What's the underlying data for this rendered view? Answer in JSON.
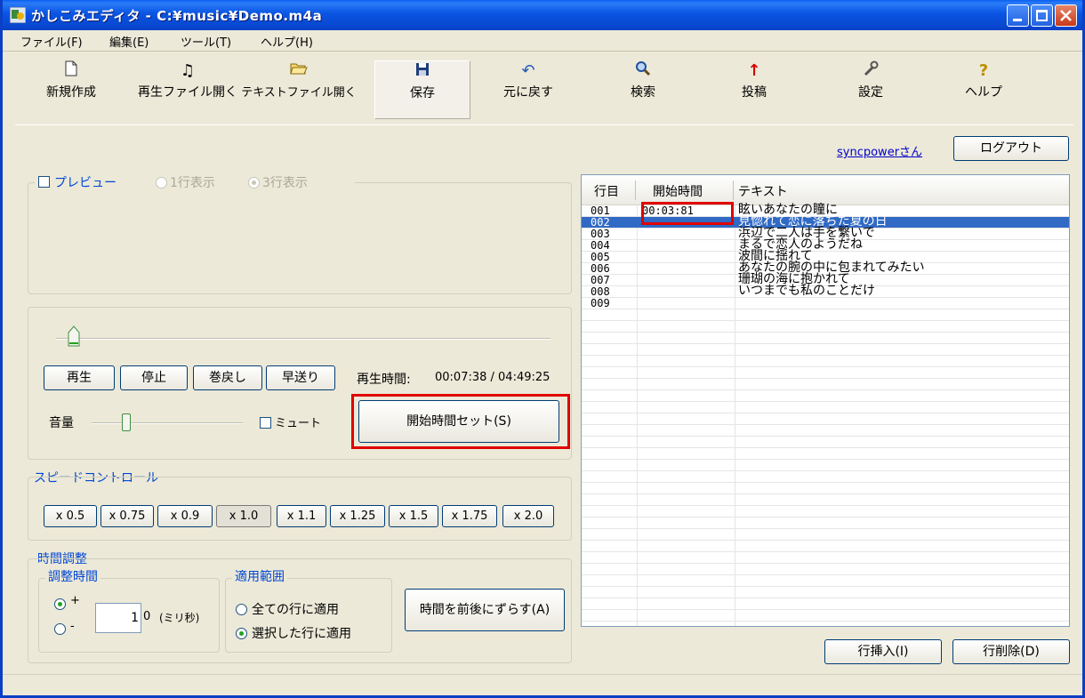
{
  "window": {
    "title": "かしこみエディタ - C:¥music¥Demo.m4a"
  },
  "menu": [
    {
      "label": "ファイル(F)"
    },
    {
      "label": "編集(E)"
    },
    {
      "label": "ツール(T)"
    },
    {
      "label": "ヘルプ(H)"
    }
  ],
  "toolbar": {
    "new": "新規作成",
    "open_audio": "再生ファイル開く",
    "open_text": "テキストファイル開く",
    "save": "保存",
    "undo": "元に戻す",
    "search": "検索",
    "post": "投稿",
    "settings": "設定",
    "help": "ヘルプ"
  },
  "account": {
    "user": "syncpowerさん",
    "logout": "ログアウト"
  },
  "preview": {
    "label": "プレビュー",
    "one_line": "1行表示",
    "three_line": "3行表示"
  },
  "player": {
    "play": "再生",
    "stop": "停止",
    "rewind": "巻戻し",
    "forward": "早送り",
    "time_label": "再生時間:",
    "time_value": "00:07:38 / 04:49:25",
    "volume": "音量",
    "mute": "ミュート",
    "set_start": "開始時間セット(S)"
  },
  "speed": {
    "label": "スピードコントロール",
    "options": [
      "x 0.5",
      "x 0.75",
      "x 0.9",
      "x 1.0",
      "x 1.1",
      "x 1.25",
      "x 1.5",
      "x 1.75",
      "x 2.0"
    ],
    "selected": "x 1.0"
  },
  "adjust": {
    "label": "時間調整",
    "amount_label": "調整時間",
    "plus": "+",
    "minus": "-",
    "value": "1",
    "unit_prefix": "0",
    "unit": "(ミリ秒)",
    "scope_label": "適用範囲",
    "scope_all": "全ての行に適用",
    "scope_selected": "選択した行に適用",
    "shift_button": "時間を前後にずらす(A)"
  },
  "table": {
    "headers": {
      "line": "行目",
      "start": "開始時間",
      "text": "テキスト"
    },
    "rows": [
      {
        "line": "001",
        "start": "00:03:81",
        "text": "眩いあなたの瞳に"
      },
      {
        "line": "002",
        "start": "",
        "text": "見惚れて恋に落ちた夏の日"
      },
      {
        "line": "003",
        "start": "",
        "text": "浜辺で二人は手を繋いで"
      },
      {
        "line": "004",
        "start": "",
        "text": "まるで恋人のようだね"
      },
      {
        "line": "005",
        "start": "",
        "text": "波間に揺れて"
      },
      {
        "line": "006",
        "start": "",
        "text": "あなたの腕の中に包まれてみたい"
      },
      {
        "line": "007",
        "start": "",
        "text": "珊瑚の海に抱かれて"
      },
      {
        "line": "008",
        "start": "",
        "text": "いつまでも私のことだけ"
      },
      {
        "line": "009",
        "start": "",
        "text": ""
      }
    ],
    "selected_row": "002",
    "insert_row": "行挿入(I)",
    "delete_row": "行削除(D)"
  },
  "colors": {
    "accent_highlight": "#E00000",
    "selection": "#316AC5",
    "titlebar": "#0A54E2"
  }
}
